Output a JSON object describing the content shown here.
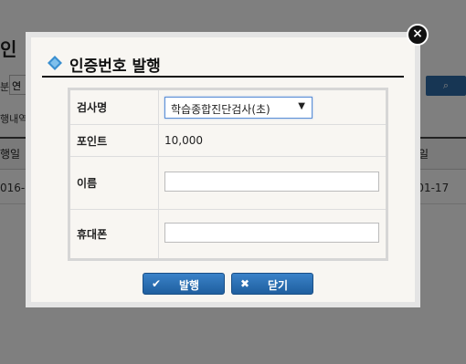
{
  "background": {
    "title": "인",
    "filter_label": "분",
    "filter_select": "연",
    "history_label": "행내역",
    "table_head_left": "행일",
    "table_head_right": "일",
    "row_date_left": "016-0",
    "row_date_right": "-01-17"
  },
  "modal": {
    "title": "인증번호 발행",
    "fields": {
      "exam_label": "검사명",
      "exam_value": "학습종합진단검사(초)",
      "point_label": "포인트",
      "point_value": "10,000",
      "name_label": "이름",
      "name_value": "",
      "phone_label": "휴대폰",
      "phone_value": ""
    },
    "buttons": {
      "issue_label": "발행",
      "close_label": "닫기"
    },
    "close_icon": "close-icon"
  },
  "colors": {
    "accent": "#2e6ca8",
    "diamond": "#3a8fd0"
  }
}
